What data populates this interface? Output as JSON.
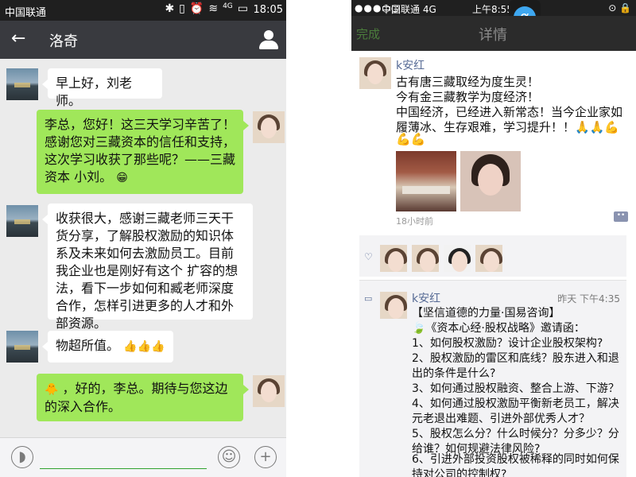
{
  "left_phone": {
    "status_bar": {
      "carrier": "中国联通",
      "time": "18:05",
      "signal": "4G"
    },
    "header": {
      "title": "洛奇",
      "back_icon": "arrow-left-icon",
      "profile_icon": "person-icon"
    },
    "messages": [
      {
        "side": "left",
        "text": "早上好，刘老师。"
      },
      {
        "side": "right",
        "text": "李总，您好！这三天学习辛苦了！感谢您对三藏资本的信任和支持，这次学习收获了那些呢？——三藏资本 小刘。",
        "emoji": "😁"
      },
      {
        "side": "left",
        "text": "收获很大，感谢三藏老师三天干货分享，了解股权激励的知识体系及未来如何去激励员工。目前我企业也是刚好有这个 扩容的想法，看下一步如何和臧老师深度合作，怎样引进更多的人才和外部资源。"
      },
      {
        "side": "left",
        "text": "物超所值。",
        "emoji": "👍👍👍"
      },
      {
        "side": "right",
        "emoji_prefix": "🐥",
        "text": "，好的，李总。期待与您这边的深入合作。"
      }
    ],
    "input_bar": {
      "voice_icon": "voice-icon",
      "emoji_icon": "smiley-icon",
      "plus_icon": "plus-icon"
    }
  },
  "right_phone": {
    "status_bar": {
      "carrier": "中国联通  4G",
      "time": "上午8:55",
      "battery": "⊙ 🔒"
    },
    "overlay_app_icon": "α",
    "nav": {
      "done": "完成",
      "title": "详情"
    },
    "post": {
      "author": "k安红",
      "lines": [
        "古有唐三藏取经为度生灵！",
        "今有金三藏教学为度经济！",
        "中国经济，已经进入新常态！当今企业家如履薄冰、生存艰难，学习提升！！🙏🙏💪",
        "💪💪"
      ],
      "time_ago": "18小时前"
    },
    "comment": {
      "author": "k安红",
      "time": "昨天 下午4:35",
      "lines": [
        "【坚信道德的力量·国易咨询】",
        "🍃《资本心经·股权战略》邀请函：",
        "1、如何股权激励？设计企业股权架构?",
        "2、股权激励的雷区和底线？股东进入和退出的条件是什么?",
        "3、如何通过股权融资、整合上游、下游？",
        "4、如何通过股权激励平衡新老员工，解决元老退出难题、引进外部优秀人才？",
        "5、股权怎么分？什么时候分？分多少？分给谁？如何规避法律风险?",
        "6、引进外部投资股权被稀释的同时如何保持对公司的控制权?"
      ]
    }
  }
}
